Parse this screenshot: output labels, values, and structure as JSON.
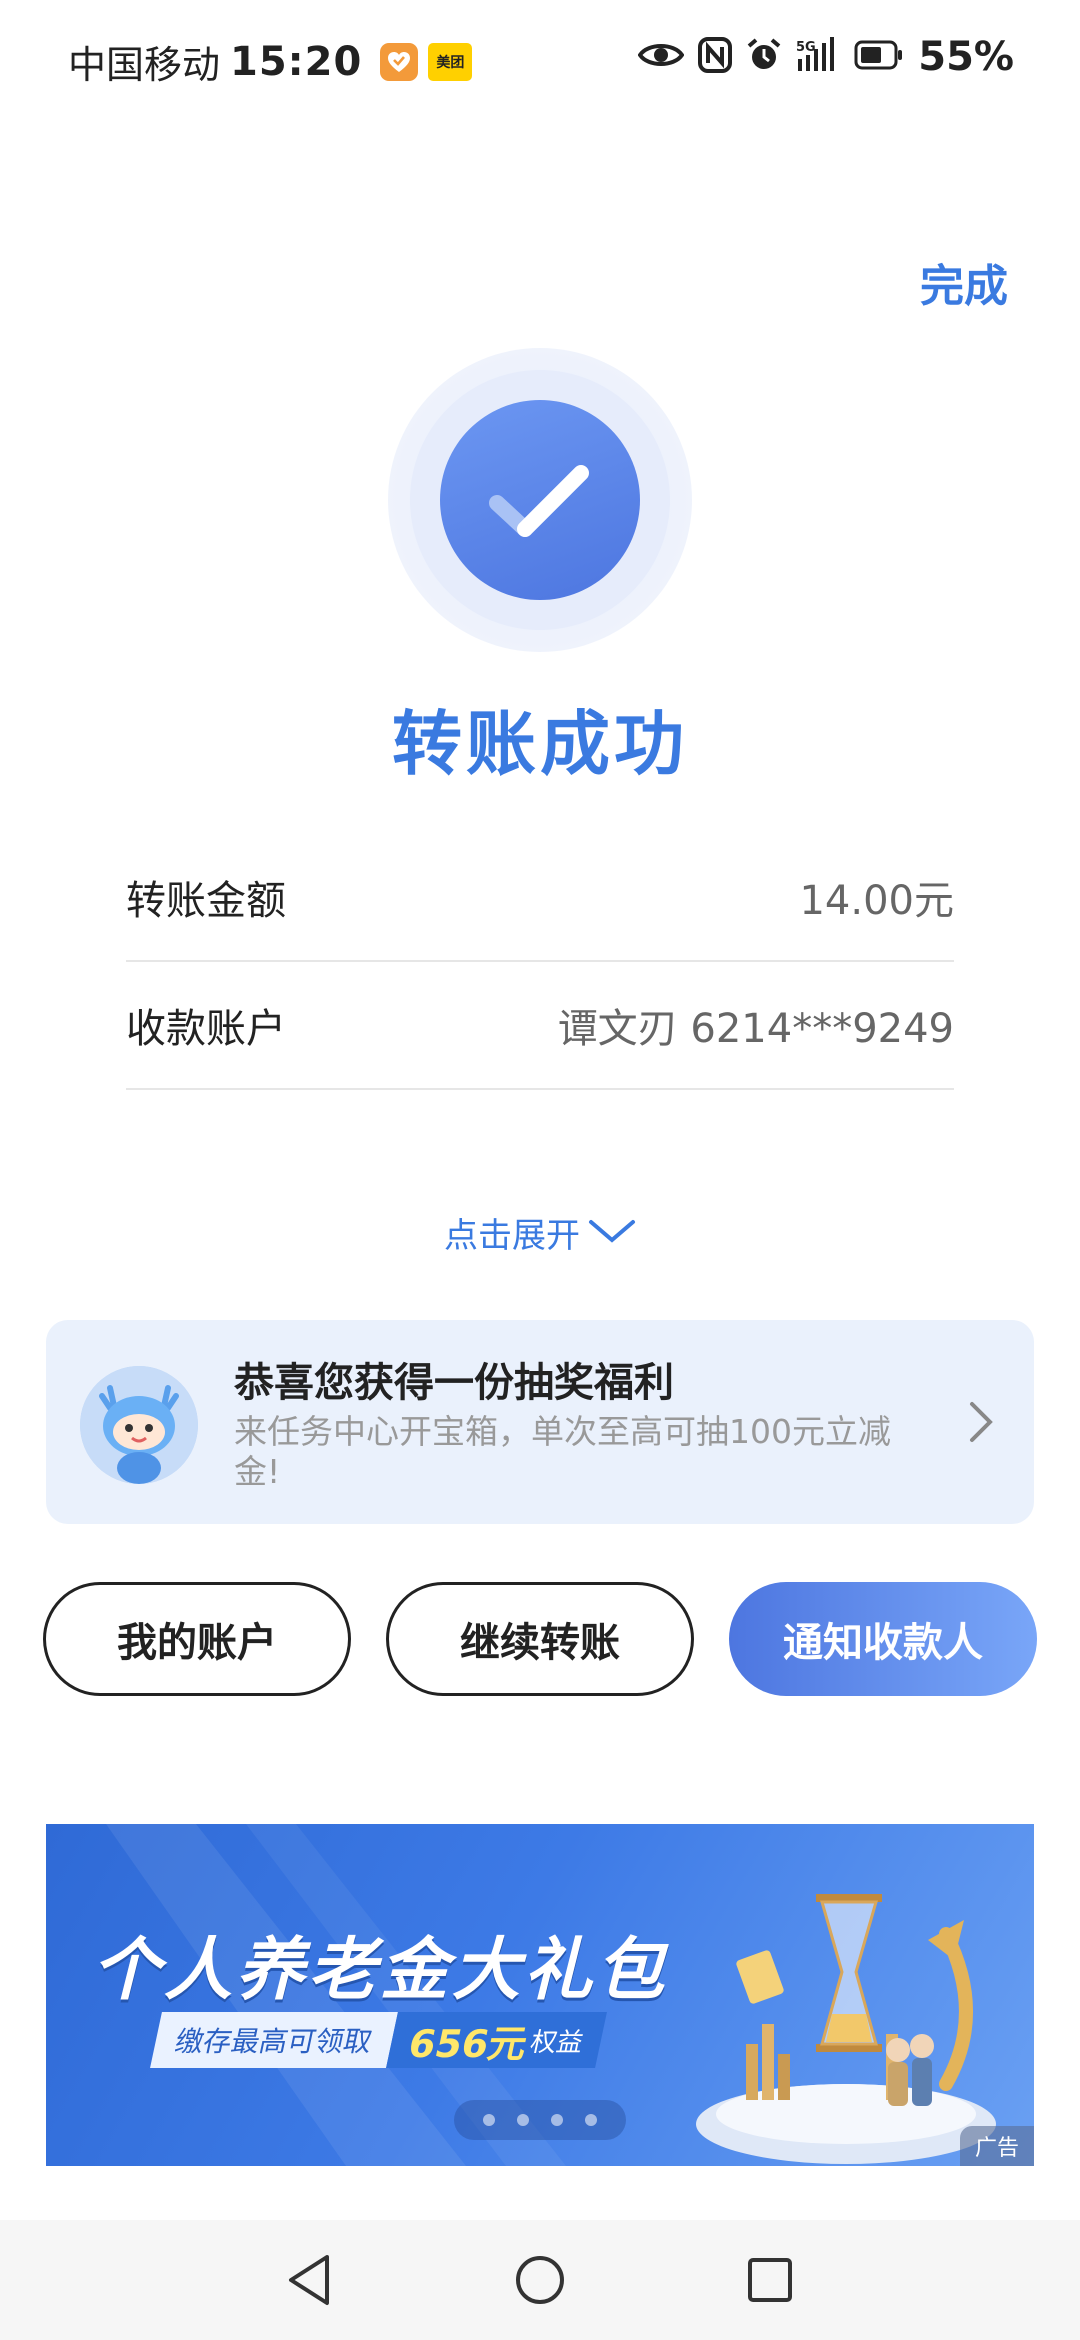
{
  "status_bar": {
    "carrier": "中国移动",
    "time": "15:20",
    "app_badge": "美团",
    "battery": "55%",
    "network": "5G"
  },
  "header": {
    "done_label": "完成"
  },
  "result": {
    "title": "转账成功"
  },
  "details": [
    {
      "label": "转账金额",
      "value": "14.00元"
    },
    {
      "label": "收款账户",
      "value": "谭文刃 6214***9249"
    }
  ],
  "expand_label": "点击展开",
  "promo": {
    "title": "恭喜您获得一份抽奖福利",
    "description": "来任务中心开宝箱，单次至高可抽100元立减金!"
  },
  "actions": {
    "my_account": "我的账户",
    "continue_transfer": "继续转账",
    "notify_payee": "通知收款人"
  },
  "banner": {
    "title": "个人养老金大礼包",
    "sub_left": "缴存最高可领取",
    "sub_amount": "656元",
    "sub_suffix": "权益",
    "ad_tag": "广告",
    "dots": 4
  },
  "colors": {
    "accent": "#3a7ae0",
    "button_gradient_start": "#4d76e0",
    "button_gradient_end": "#79a6f8",
    "promo_bg": "#eaf1fc"
  }
}
